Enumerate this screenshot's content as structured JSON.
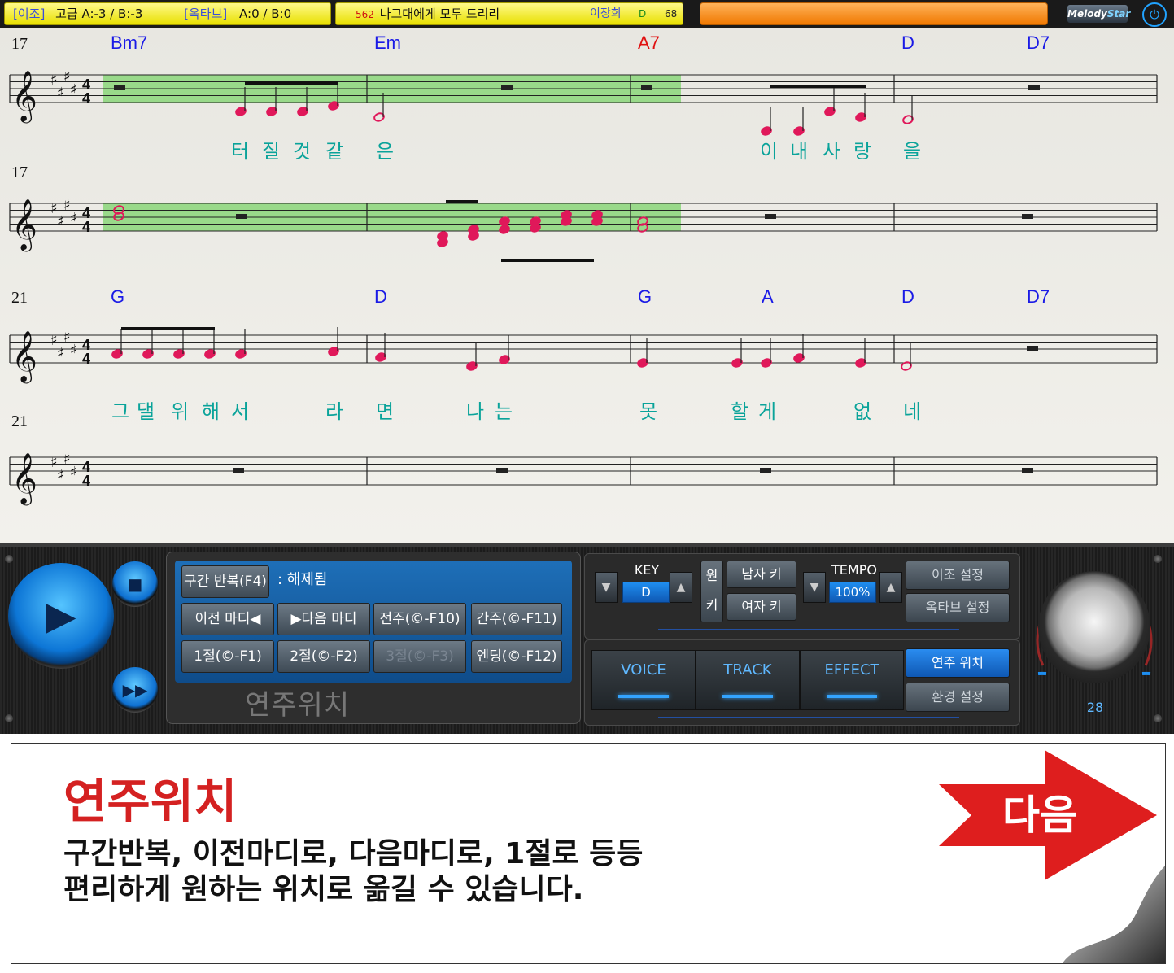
{
  "top_bar": {
    "transpose_label": "[이조]",
    "transpose_value": "고급 A:-3 / B:-3",
    "octave_label": "[옥타브]",
    "octave_value": "A:0 / B:0",
    "song_number": "562",
    "song_title": "나그대에게 모두 드리리",
    "singer": "이장희",
    "song_key": "D",
    "song_tempo": "68",
    "logo_text_a": "Melody",
    "logo_text_b": "Star",
    "power_icon": "power-icon"
  },
  "score": {
    "systems": [
      {
        "measure_number": "17",
        "chords": [
          "Bm7",
          "Em",
          "A7",
          "D",
          "D7"
        ],
        "lyrics": [
          "터",
          "질",
          "것",
          "같",
          "은",
          "이",
          "내",
          "사",
          "랑",
          "을"
        ]
      },
      {
        "measure_number": "17"
      },
      {
        "measure_number": "21",
        "chords": [
          "G",
          "D",
          "G",
          "A",
          "D",
          "D7"
        ],
        "lyrics": [
          "그",
          "댈",
          "위",
          "해",
          "서",
          "라",
          "면",
          "나",
          "는",
          "못",
          "할",
          "게",
          "없",
          "네"
        ]
      },
      {
        "measure_number": "21"
      }
    ],
    "time_signature": "4/4",
    "colors": {
      "highlight": "#99d98a",
      "note": "#e0185a",
      "chord": "#1a1ae6",
      "chord_alt": "#e01010",
      "lyric": "#0aa39a"
    }
  },
  "controls": {
    "play_icon": "play-icon",
    "stop_icon": "stop-icon",
    "fast_forward_icon": "fast-forward-icon",
    "repeat_button": "구간 반복(F4)",
    "repeat_status": ": 해제됨",
    "prev_measure": "이전 마디◀",
    "next_measure": "▶다음 마디",
    "prelude": "전주(©-F10)",
    "interlude": "간주(©-F11)",
    "verse1": "1절(©-F1)",
    "verse2": "2절(©-F2)",
    "verse3": "3절(©-F3)",
    "ending": "엔딩(©-F12)",
    "panel_title": "연주위치"
  },
  "settings": {
    "key_label": "KEY",
    "key_value": "D",
    "original_key_line1": "원",
    "original_key_line2": "키",
    "male_key": "남자 키",
    "female_key": "여자 키",
    "tempo_label": "TEMPO",
    "tempo_value": "100%",
    "transpose_settings": "이조 설정",
    "octave_settings": "옥타브 설정",
    "tabs": [
      "VOICE",
      "TRACK",
      "EFFECT"
    ],
    "play_position": "연주 위치",
    "env_settings": "환경 설정",
    "volume": "28"
  },
  "info_card": {
    "title": "연주위치",
    "line1": "구간반복, 이전마디로, 다음마디로, 1절로 등등",
    "line2": "편리하게 원하는 위치로 옮길 수 있습니다.",
    "next_label": "다음"
  }
}
